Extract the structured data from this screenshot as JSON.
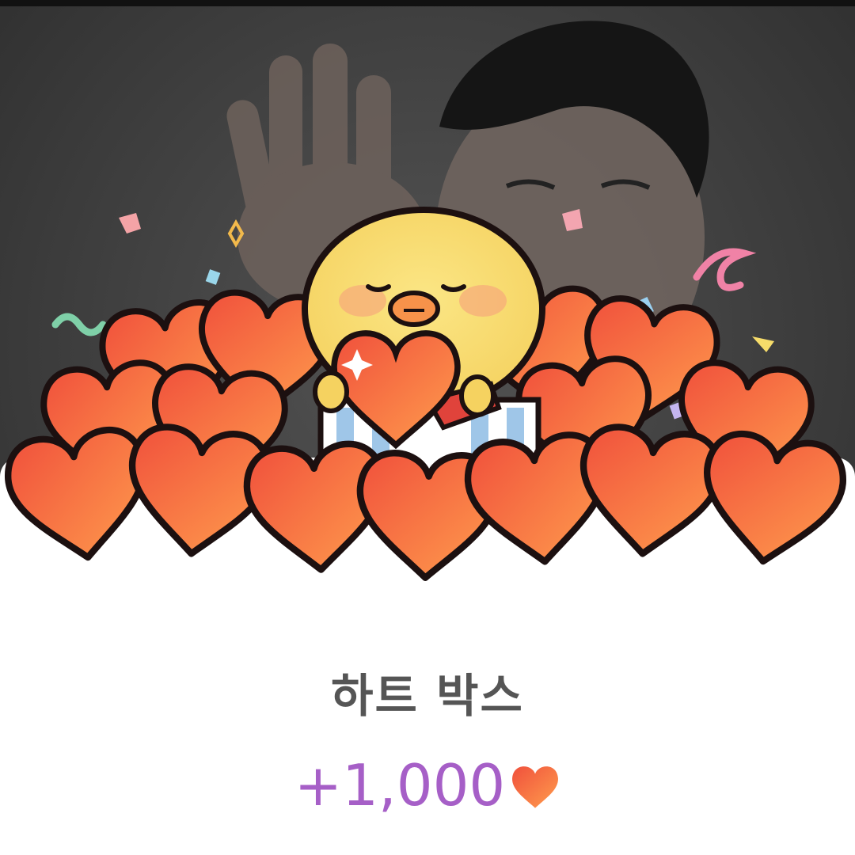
{
  "reward": {
    "title": "하트 박스",
    "amount": "+1,000",
    "currency_icon": "heart-icon"
  },
  "colors": {
    "amount_purple": "#a65fc7",
    "heart_red": "#f0503c",
    "heart_orange": "#ff9a4a",
    "chick_yellow": "#f9dc6d",
    "title_gray": "#555555"
  }
}
